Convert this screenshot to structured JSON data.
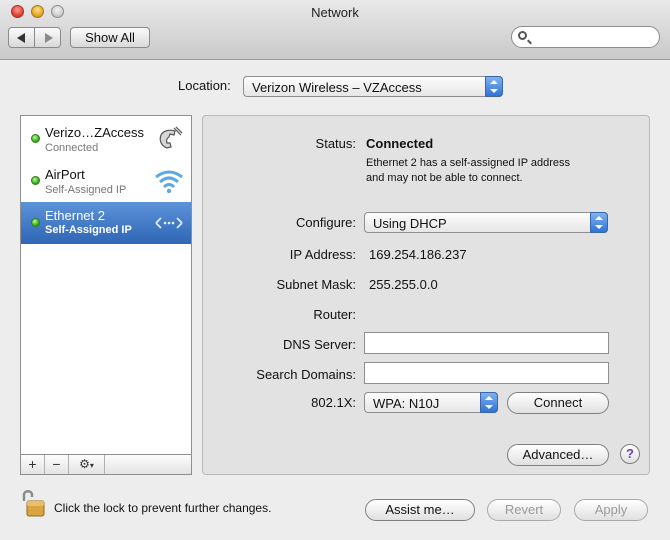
{
  "window": {
    "title": "Network"
  },
  "toolbar": {
    "show_all_label": "Show All",
    "search": {
      "value": "",
      "placeholder": ""
    }
  },
  "location": {
    "label": "Location:",
    "selected": "Verizon Wireless – VZAccess"
  },
  "services": [
    {
      "name": "Verizo…ZAccess",
      "status": "Connected",
      "icon": "phone-icon",
      "status_color": "#37b31a"
    },
    {
      "name": "AirPort",
      "status": "Self-Assigned IP",
      "icon": "wifi-icon",
      "status_color": "#37b31a"
    },
    {
      "name": "Ethernet 2",
      "status": "Self-Assigned IP",
      "icon": "ethernet-icon",
      "status_color": "#37b31a",
      "selected": true
    }
  ],
  "list_toolbar": {
    "add": "+",
    "remove": "−",
    "action": "⚙"
  },
  "detail": {
    "status_label": "Status:",
    "status_value": "Connected",
    "status_desc_line1": "Ethernet 2 has a self-assigned IP address",
    "status_desc_line2": "and may not be able to connect.",
    "configure_label": "Configure:",
    "configure_value": "Using DHCP",
    "ip_label": "IP Address:",
    "ip_value": "169.254.186.237",
    "subnet_label": "Subnet Mask:",
    "subnet_value": "255.255.0.0",
    "router_label": "Router:",
    "router_value": "",
    "dns_label": "DNS Server:",
    "dns_value": "",
    "search_domains_label": "Search Domains:",
    "search_domains_value": "",
    "dot1x_label": "802.1X:",
    "dot1x_value": "WPA: N10J",
    "connect_label": "Connect",
    "advanced_label": "Advanced…",
    "help_label": "?"
  },
  "footer": {
    "lock_text": "Click the lock to prevent further changes.",
    "assist_label": "Assist me…",
    "revert_label": "Revert",
    "apply_label": "Apply"
  },
  "colors": {
    "selection": "#2f66b6",
    "accent": "#2f73d6",
    "status_green": "#37b31a"
  }
}
